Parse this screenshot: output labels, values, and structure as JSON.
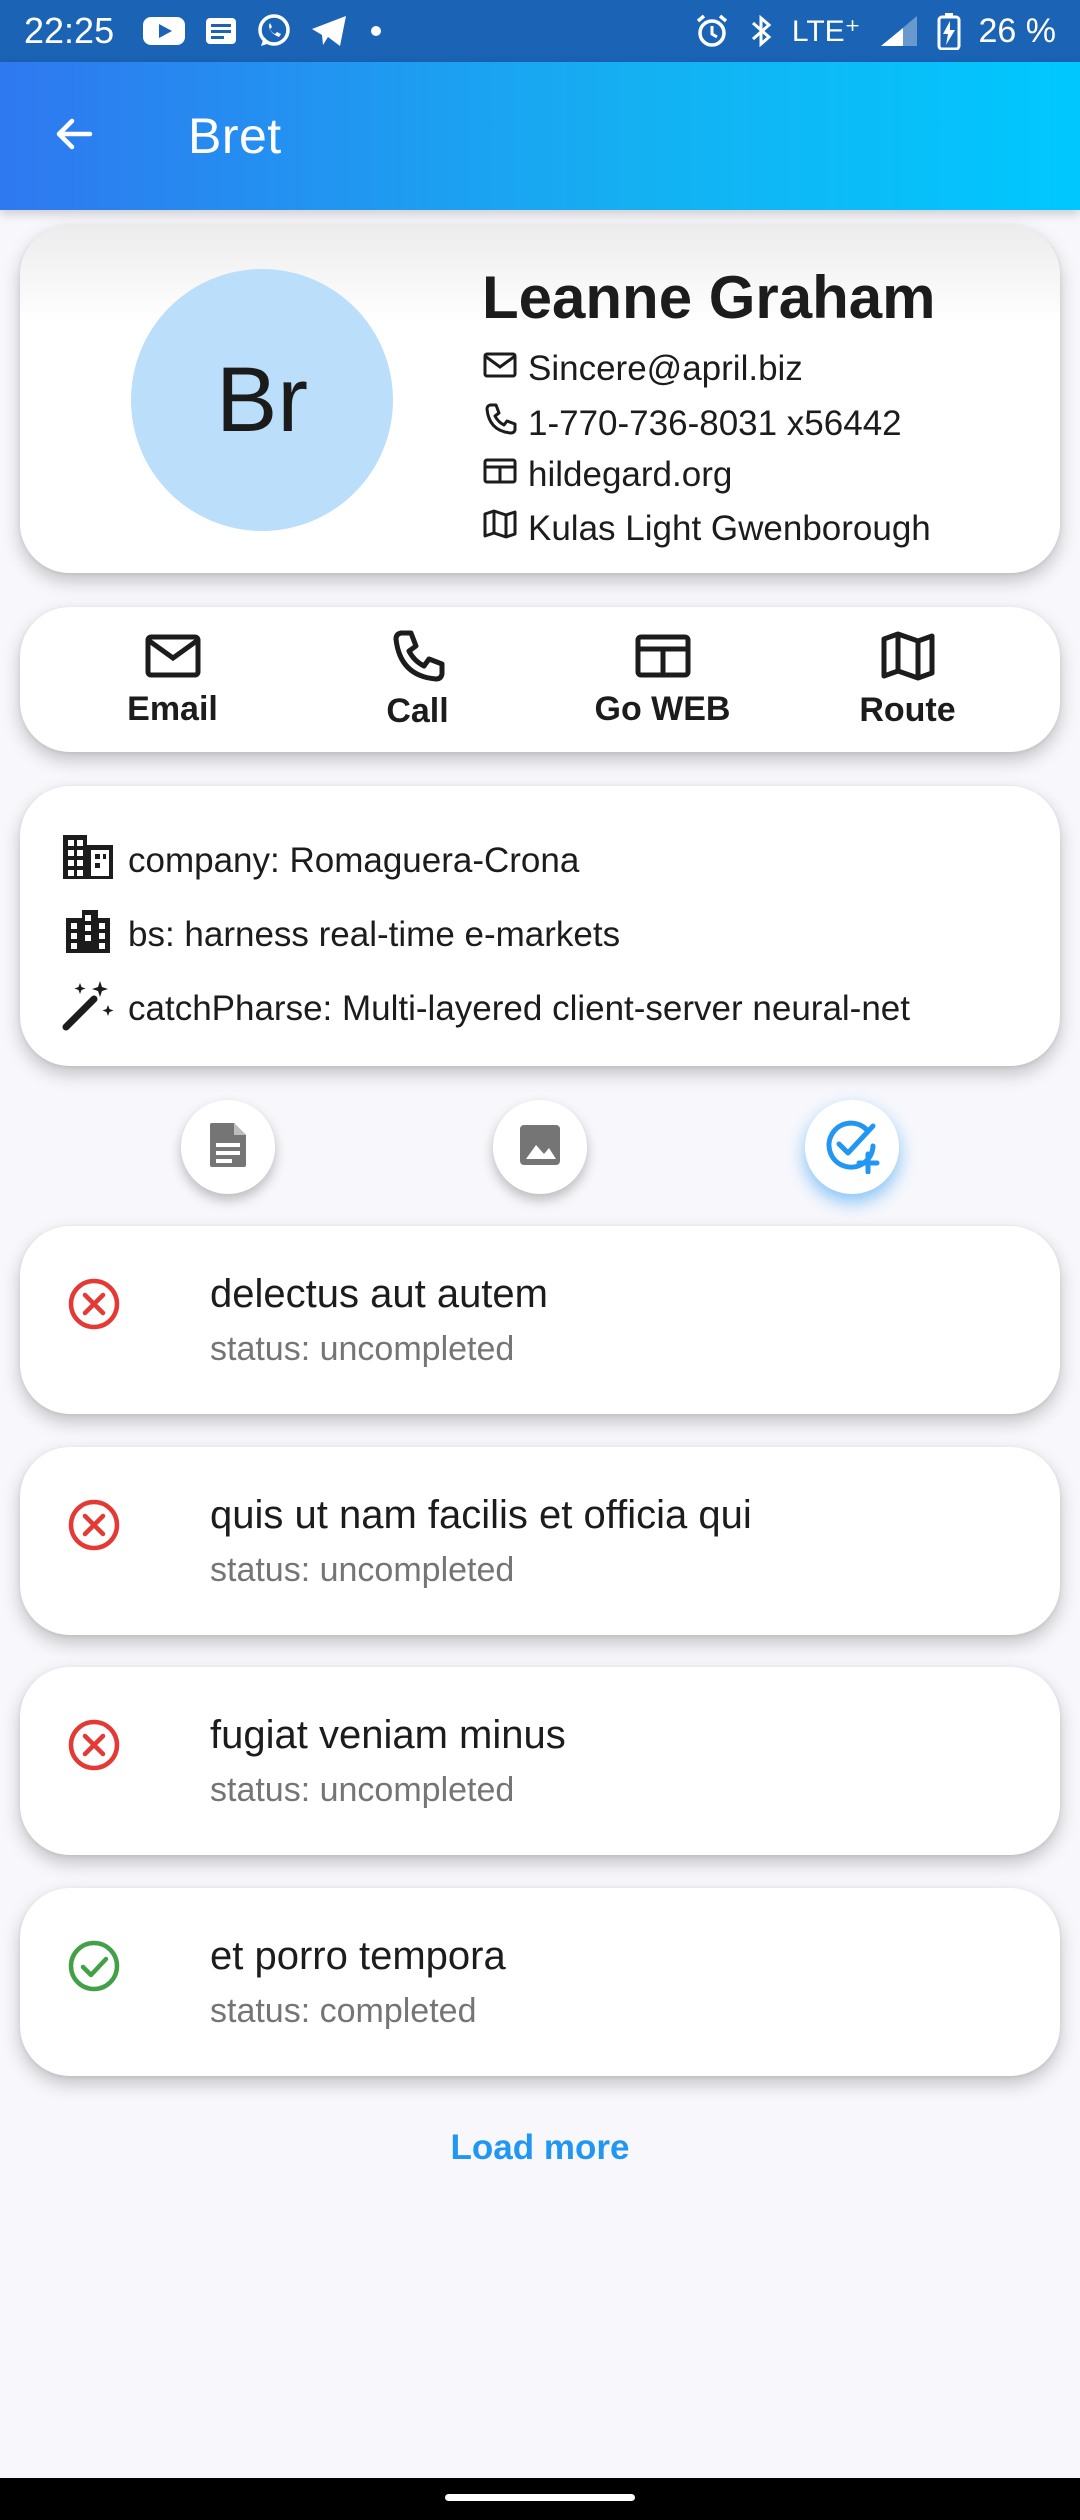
{
  "status_bar": {
    "time": "22:25",
    "network": "LTE⁺",
    "battery": "26 %",
    "icons": [
      "youtube-icon",
      "news-icon",
      "whatsapp-icon",
      "telegram-icon",
      "dot-icon",
      "alarm-icon",
      "bluetooth-icon",
      "signal-icon",
      "battery-charging-icon"
    ]
  },
  "app_bar": {
    "title": "Bret",
    "back_icon": "arrow-back-icon"
  },
  "profile": {
    "avatar_initials": "Br",
    "name": "Leanne Graham",
    "email": "Sincere@april.biz",
    "phone": "1-770-736-8031 x56442",
    "website": "hildegard.org",
    "address": "Kulas Light Gwenborough"
  },
  "actions": [
    {
      "label": "Email",
      "icon": "mail-icon"
    },
    {
      "label": "Call",
      "icon": "phone-icon"
    },
    {
      "label": "Go WEB",
      "icon": "web-icon"
    },
    {
      "label": "Route",
      "icon": "map-icon"
    }
  ],
  "company": {
    "company_line": "company: Romaguera-Crona",
    "bs_line": "bs: harness real-time e-markets",
    "catchphrase_line": "catchPharse: Multi-layered client-server neural-net"
  },
  "tabs": [
    {
      "icon": "posts-icon",
      "active": false
    },
    {
      "icon": "photos-icon",
      "active": false
    },
    {
      "icon": "todos-icon",
      "active": true
    }
  ],
  "todos": [
    {
      "title": "delectus aut autem",
      "status": "status: uncompleted",
      "completed": false
    },
    {
      "title": "quis ut nam facilis et officia qui",
      "status": "status: uncompleted",
      "completed": false
    },
    {
      "title": "fugiat veniam minus",
      "status": "status: uncompleted",
      "completed": false
    },
    {
      "title": "et porro tempora",
      "status": "status: completed",
      "completed": true
    }
  ],
  "load_more_label": "Load more",
  "colors": {
    "accent": "#2196f3",
    "error": "#e53935",
    "success": "#43a047",
    "avatar_bg": "#bbdefb"
  }
}
